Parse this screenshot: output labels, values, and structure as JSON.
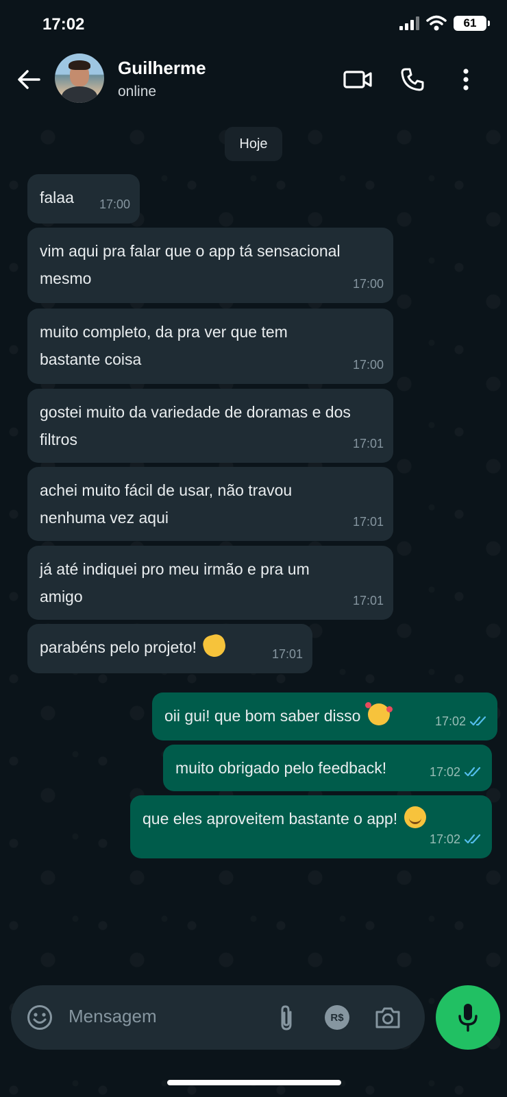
{
  "status_bar": {
    "time": "17:02",
    "battery": "61"
  },
  "header": {
    "contact_name": "Guilherme",
    "contact_status": "online"
  },
  "date_chip": "Hoje",
  "messages": [
    {
      "dir": "in",
      "text": "falaa",
      "time": "17:00"
    },
    {
      "dir": "in",
      "text": "vim aqui pra falar que o app tá sensacional mesmo",
      "time": "17:00"
    },
    {
      "dir": "in",
      "text": "muito completo, da pra ver que tem bastante coisa",
      "time": "17:00"
    },
    {
      "dir": "in",
      "text": "gostei muito da variedade de doramas e dos filtros",
      "time": "17:01"
    },
    {
      "dir": "in",
      "text": "achei muito fácil de usar, não travou nenhuma vez aqui",
      "time": "17:01"
    },
    {
      "dir": "in",
      "text": "já até indiquei pro meu irmão e pra um amigo",
      "time": "17:01"
    },
    {
      "dir": "in",
      "text": "parabéns pelo projeto!",
      "emoji": "clapping-hands",
      "time": "17:01"
    },
    {
      "dir": "out",
      "text": "oii gui! que bom saber disso",
      "emoji": "smiling-face-with-hearts",
      "time": "17:02",
      "read": true
    },
    {
      "dir": "out",
      "text": "muito obrigado pelo feedback!",
      "time": "17:02",
      "read": true
    },
    {
      "dir": "out",
      "text": "que eles aproveitem bastante o app!",
      "emoji": "smiling-face",
      "time": "17:02",
      "read": true
    }
  ],
  "composer": {
    "placeholder": "Mensagem",
    "payment_label": "R$"
  },
  "colors": {
    "background": "#0b141a",
    "incoming_bubble": "#1f2c34",
    "outgoing_bubble": "#005c4b",
    "read_ticks": "#53bdeb",
    "mic_button": "#21c063"
  },
  "icons": [
    "back-arrow-icon",
    "video-call-icon",
    "phone-icon",
    "more-vert-icon",
    "emoji-icon",
    "attach-icon",
    "payment-icon",
    "camera-icon",
    "mic-icon",
    "double-check-icon"
  ]
}
